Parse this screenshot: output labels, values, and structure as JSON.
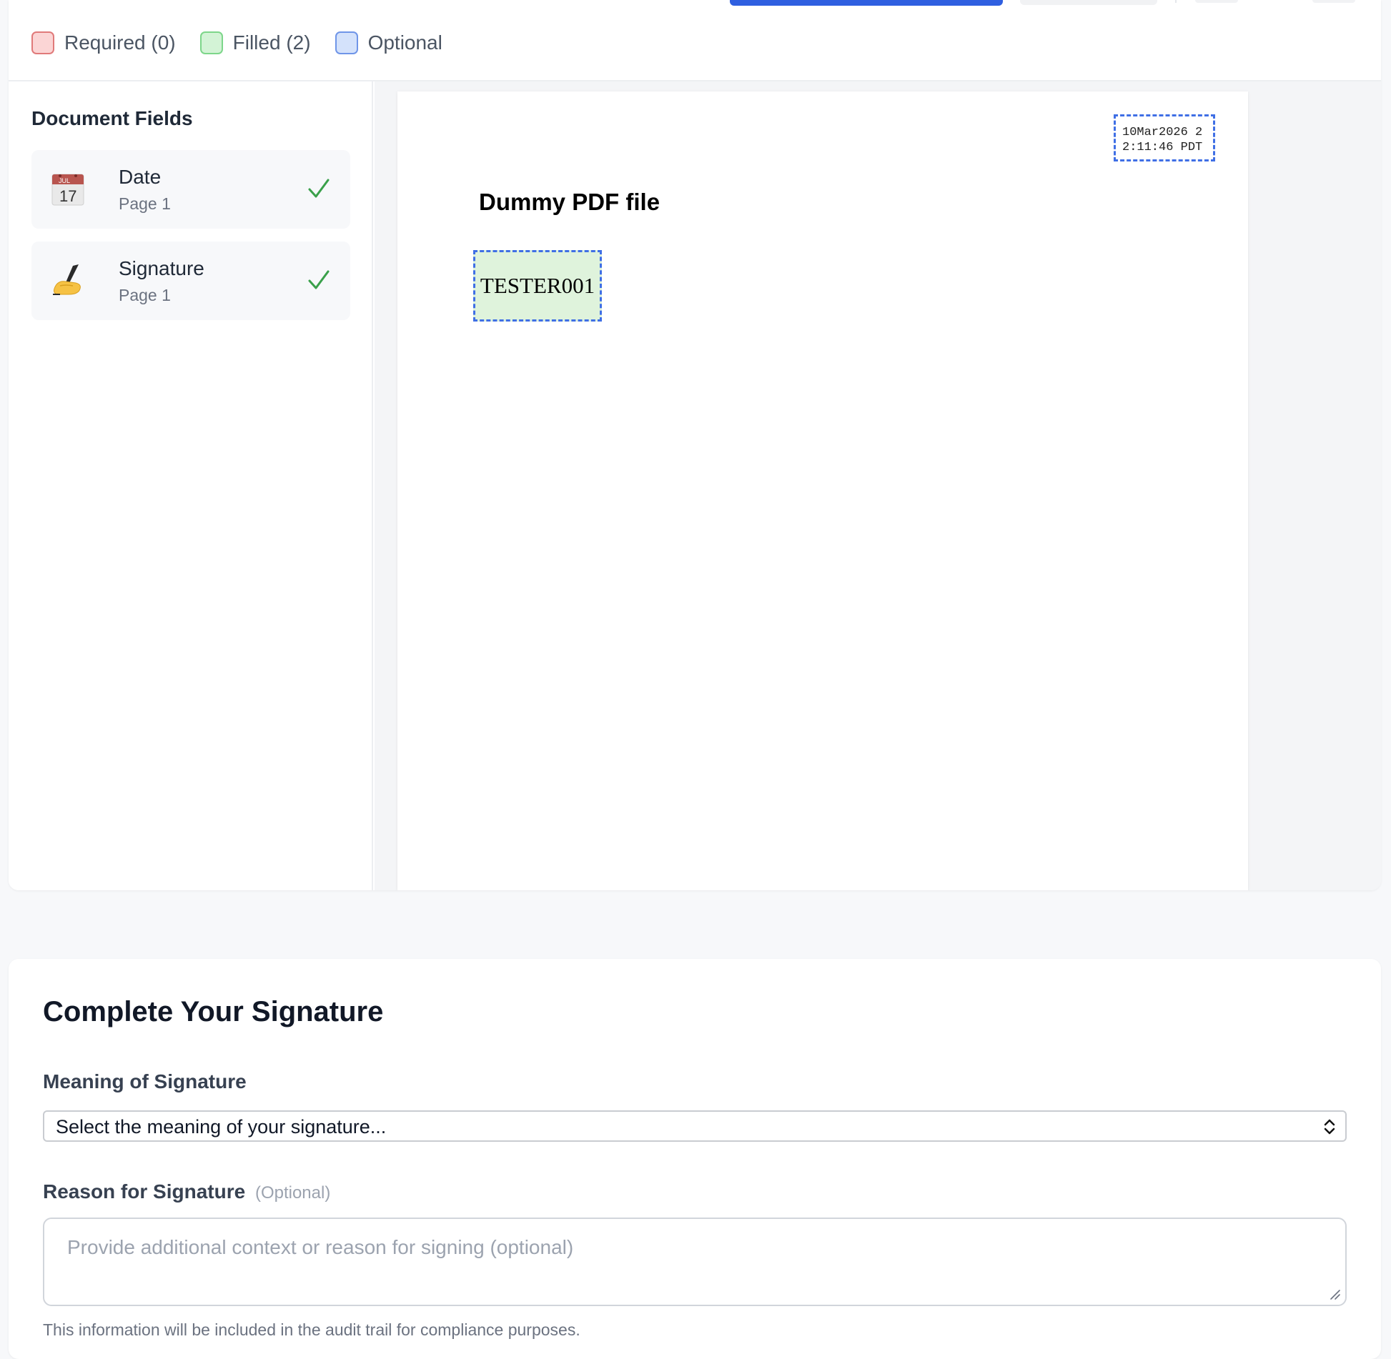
{
  "legend": {
    "required": "Required (0)",
    "filled": "Filled (2)",
    "optional": "Optional"
  },
  "sidebar": {
    "title": "Document Fields",
    "items": [
      {
        "name": "Date",
        "page": "Page 1",
        "icon": "calendar-icon",
        "status": "complete"
      },
      {
        "name": "Signature",
        "page": "Page 1",
        "icon": "writing-hand-icon",
        "status": "complete"
      }
    ]
  },
  "document": {
    "title": "Dummy PDF file",
    "date_field_value_line1": "10Mar2026 2",
    "date_field_value_line2": "2:11:46 PDT",
    "signature_field_value": "TESTER001",
    "calendar_icon_month": "JUL",
    "calendar_icon_day": "17"
  },
  "signature_form": {
    "title": "Complete Your Signature",
    "meaning_label": "Meaning of Signature",
    "meaning_placeholder": "Select the meaning of your signature...",
    "reason_label": "Reason for Signature",
    "reason_optional": "(Optional)",
    "reason_placeholder": "Provide additional context or reason for signing (optional)",
    "help_text": "This information will be included in the audit trail for compliance purposes."
  },
  "colors": {
    "accent": "#2f5fe0",
    "field_border": "#3f6fe5",
    "filled_bg": "#dff3dc",
    "check": "#3aa04a"
  }
}
